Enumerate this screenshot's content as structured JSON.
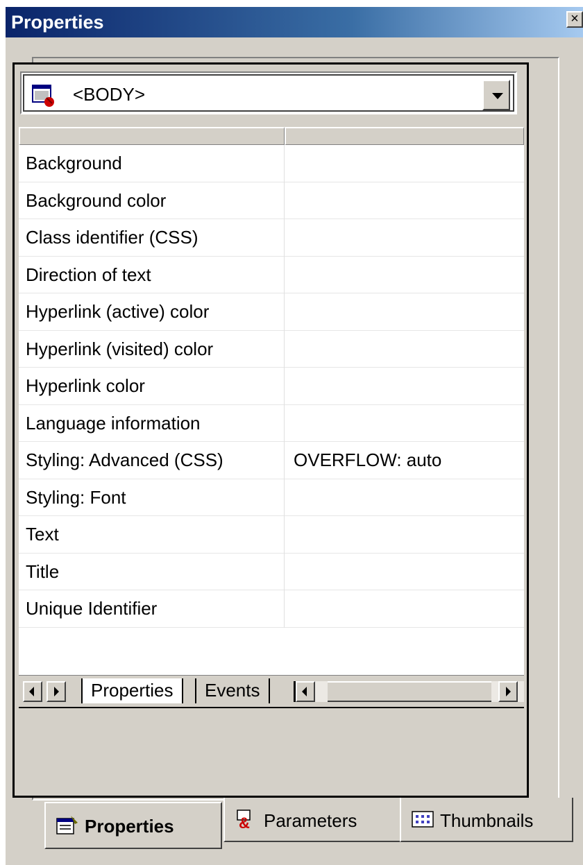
{
  "window": {
    "title": "Properties",
    "close_glyph": "×"
  },
  "element_selector": {
    "value": "<BODY>",
    "icon": "html-element-icon"
  },
  "property_grid": {
    "rows": [
      {
        "name": "Background",
        "value": ""
      },
      {
        "name": "Background color",
        "value": ""
      },
      {
        "name": "Class identifier (CSS)",
        "value": ""
      },
      {
        "name": "Direction of text",
        "value": ""
      },
      {
        "name": "Hyperlink (active) color",
        "value": ""
      },
      {
        "name": "Hyperlink (visited) color",
        "value": ""
      },
      {
        "name": "Hyperlink color",
        "value": ""
      },
      {
        "name": "Language information",
        "value": ""
      },
      {
        "name": "Styling: Advanced (CSS)",
        "value": "OVERFLOW: auto"
      },
      {
        "name": "Styling: Font",
        "value": ""
      },
      {
        "name": "Text",
        "value": ""
      },
      {
        "name": "Title",
        "value": ""
      },
      {
        "name": "Unique Identifier",
        "value": ""
      }
    ]
  },
  "sheet_tabs": {
    "properties": "Properties",
    "events": "Events"
  },
  "bottom_tabs": {
    "properties": "Properties",
    "parameters": "Parameters",
    "thumbnails": "Thumbnails"
  },
  "colors": {
    "titlebar_start": "#0a246a",
    "titlebar_end": "#a6caf0",
    "face": "#d4d0c8"
  }
}
